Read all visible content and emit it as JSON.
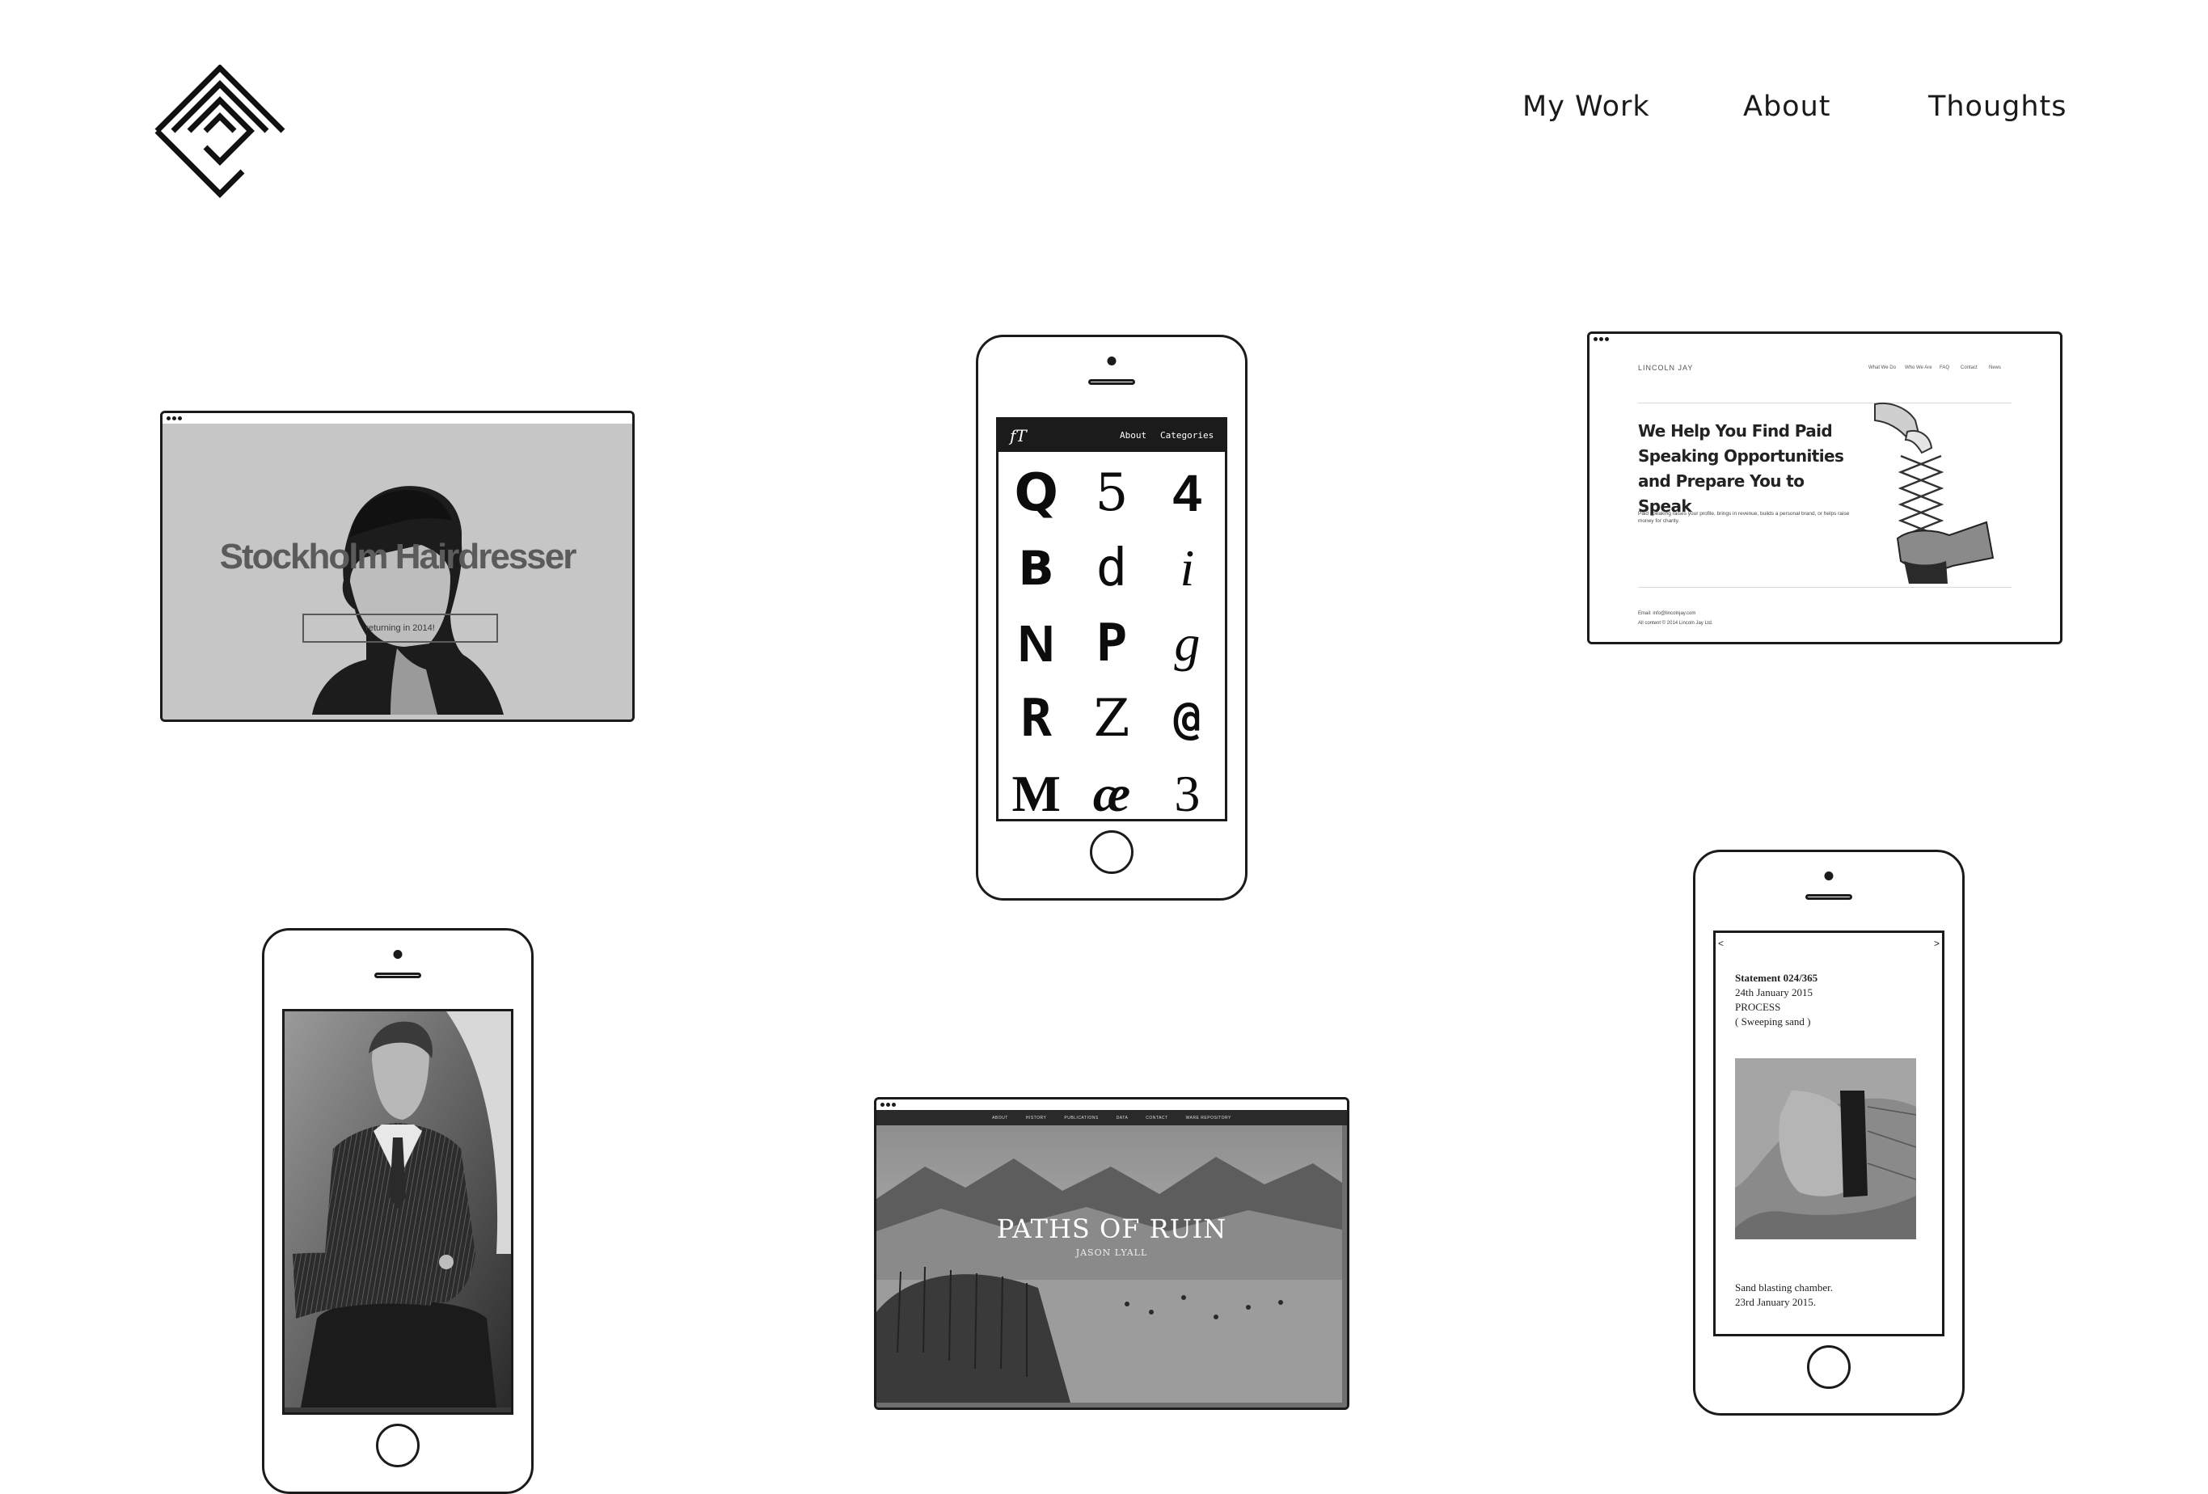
{
  "nav": {
    "my_work": "My Work",
    "about": "About",
    "thoughts": "Thoughts"
  },
  "portfolio": {
    "stockholm": {
      "title": "Stockholm Hairdresser",
      "notice": "returning in 2014!"
    },
    "typeface": {
      "logo": "fT",
      "links": [
        "About",
        "Categories"
      ],
      "glyphs": [
        "Q",
        "5",
        "4",
        "B",
        "d",
        "i",
        "N",
        "P",
        "g",
        "R",
        "Z",
        "@",
        "M",
        "æ",
        "3"
      ]
    },
    "lincoln": {
      "brand": "LINCOLN JAY",
      "menu": [
        "What We Do",
        "Who We Are",
        "FAQ",
        "Contact",
        "News"
      ],
      "headline": "We Help You Find Paid Speaking Opportunities and Prepare You to Speak",
      "body": "Paid speaking raises your profile, brings in revenue, builds a personal brand, or helps raise money for charity.",
      "email": "Email: info@lincolnjay.com",
      "copyright": "All content © 2014 Lincoln Jay Ltd."
    },
    "paths": {
      "menu": [
        "ABOUT",
        "HISTORY",
        "PUBLICATIONS",
        "DATA",
        "CONTACT",
        "WARE REPOSITORY"
      ],
      "title": "PATHS OF RUIN",
      "author": "JASON LYALL"
    },
    "statement": {
      "prev": "<",
      "next": ">",
      "heading": "Statement 024/365",
      "date": "24th January 2015",
      "category": "PROCESS",
      "subject": "( Sweeping sand )",
      "caption": "Sand blasting chamber.",
      "caption_date": "23rd January 2015."
    }
  },
  "colors": {
    "ink": "#1b1b1b",
    "background": "#ffffff",
    "screen_gray": "#c6c6c6"
  },
  "icons": {
    "logo": "nested-chevron-diamond-logo"
  }
}
